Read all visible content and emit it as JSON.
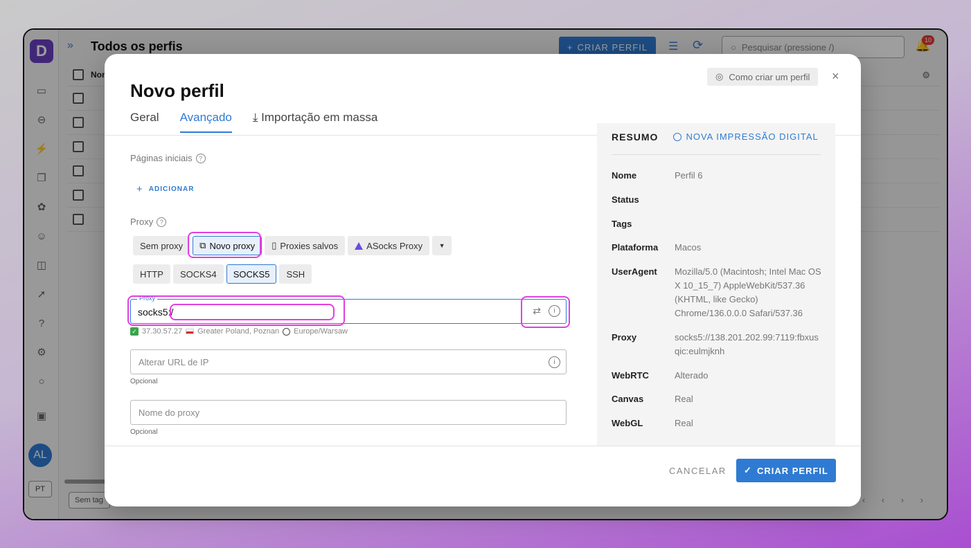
{
  "app": {
    "title": "Todos os perfis",
    "create_button": "CRIAR PERFIL",
    "search_placeholder": "Pesquisar (pressione /)",
    "notification_count": "10",
    "table_header": "Nom",
    "avatar": "AL",
    "language": "PT",
    "footer_filter": "Sem tag"
  },
  "modal": {
    "title": "Novo perfil",
    "help_link": "Como criar um perfil",
    "close": "×",
    "tabs": [
      "Geral",
      "Avançado",
      "Importação em massa"
    ],
    "start_pages": {
      "label": "Páginas iniciais",
      "add_label": "ADICIONAR"
    },
    "proxy": {
      "label": "Proxy",
      "modes": [
        "Sem proxy",
        "Novo proxy",
        "Proxies salvos",
        "ASocks Proxy"
      ],
      "selected_mode": "Novo proxy",
      "types": [
        "HTTP",
        "SOCKS4",
        "SOCKS5",
        "SSH"
      ],
      "selected_type": "SOCKS5",
      "field_legend": "Proxy",
      "field_value": "socks5:/",
      "ip": "37.30.57.27",
      "location": "Greater Poland, Poznan",
      "timezone": "Europe/Warsaw"
    },
    "change_ip_url": {
      "placeholder": "Alterar URL de IP",
      "hint": "Opcional"
    },
    "proxy_name": {
      "placeholder": "Nome do proxy",
      "hint": "Opcional"
    },
    "summary": {
      "title": "RESUMO",
      "new_fingerprint": "NOVA IMPRESSÃO DIGITAL",
      "rows": [
        {
          "key": "Nome",
          "value": "Perfil 6"
        },
        {
          "key": "Status",
          "value": ""
        },
        {
          "key": "Tags",
          "value": ""
        },
        {
          "key": "Plataforma",
          "value": "Macos"
        },
        {
          "key": "UserAgent",
          "value": "Mozilla/5.0 (Macintosh; Intel Mac OS X 10_15_7) AppleWebKit/537.36 (KHTML, like Gecko) Chrome/136.0.0.0 Safari/537.36"
        },
        {
          "key": "Proxy",
          "value": "socks5://138.201.202.99:7119:fbxusqic:eulmjknh"
        },
        {
          "key": "WebRTC",
          "value": "Alterado"
        },
        {
          "key": "Canvas",
          "value": "Real"
        },
        {
          "key": "WebGL",
          "value": "Real"
        }
      ]
    },
    "footer": {
      "cancel": "CANCELAR",
      "create": "CRIAR PERFIL"
    }
  }
}
